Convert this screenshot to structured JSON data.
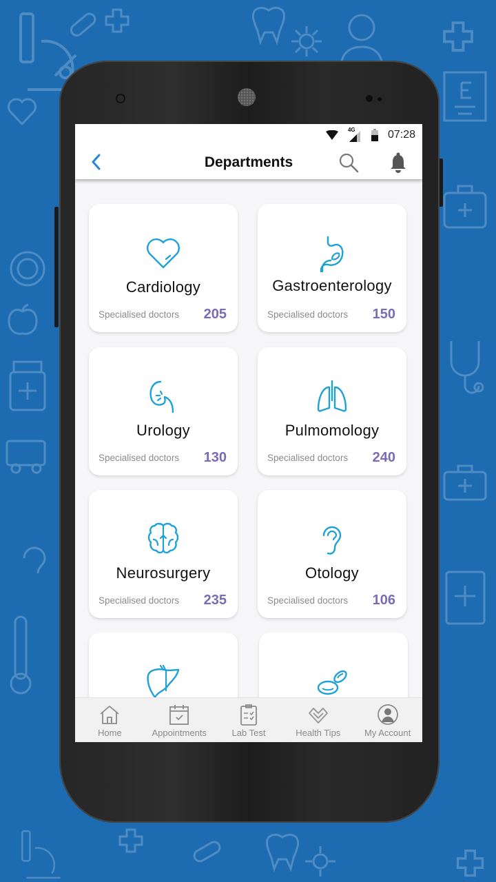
{
  "status_bar": {
    "network": "4G",
    "time": "07:28"
  },
  "app_bar": {
    "title": "Departments",
    "back_icon": "chevron-left-icon",
    "search_icon": "search-icon",
    "notification_icon": "bell-icon"
  },
  "departments": [
    {
      "name": "Cardiology",
      "subtitle": "Specialised doctors",
      "count": "205",
      "icon": "heart-icon"
    },
    {
      "name": "Gastroenterology",
      "subtitle": "Specialised doctors",
      "count": "150",
      "icon": "stomach-icon"
    },
    {
      "name": "Urology",
      "subtitle": "Specialised doctors",
      "count": "130",
      "icon": "kidney-icon"
    },
    {
      "name": "Pulmomology",
      "subtitle": "Specialised doctors",
      "count": "240",
      "icon": "lungs-icon"
    },
    {
      "name": "Neurosurgery",
      "subtitle": "Specialised doctors",
      "count": "235",
      "icon": "brain-icon"
    },
    {
      "name": "Otology",
      "subtitle": "Specialised doctors",
      "count": "106",
      "icon": "ear-icon"
    },
    {
      "icon": "liver-icon"
    },
    {
      "icon": "blood-cells-icon"
    }
  ],
  "bottom_nav": [
    {
      "label": "Home",
      "icon": "home-icon"
    },
    {
      "label": "Appointments",
      "icon": "calendar-icon"
    },
    {
      "label": "Lab Test",
      "icon": "clipboard-icon"
    },
    {
      "label": "Health Tips",
      "icon": "health-tips-icon"
    },
    {
      "label": "My Account",
      "icon": "account-icon"
    }
  ],
  "colors": {
    "background": "#1d6bb0",
    "accent_blue": "#1e88e5",
    "icon_blue": "#1da1d6",
    "count_purple": "#7a6bb6",
    "subtitle_gray": "#8b8b8b"
  }
}
